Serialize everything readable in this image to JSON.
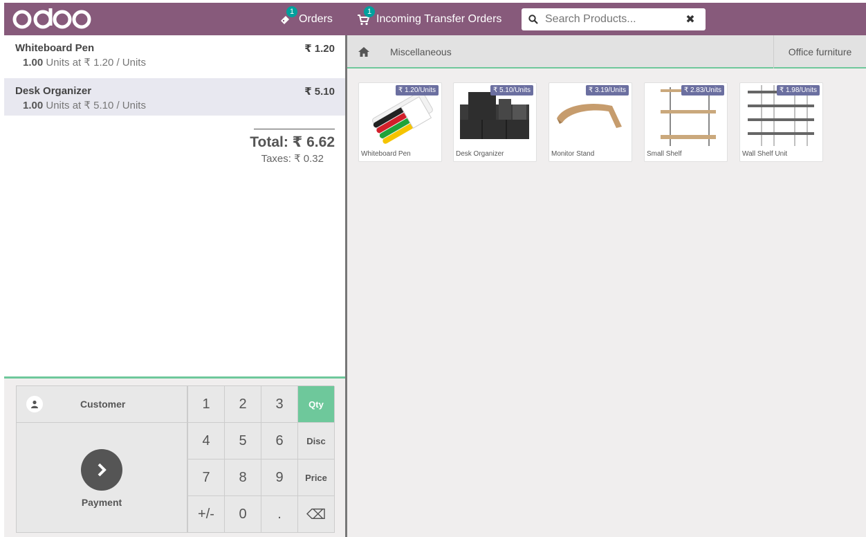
{
  "header": {
    "logo_text": "odoo",
    "orders": {
      "label": "Orders",
      "badge": "1"
    },
    "transfers": {
      "label": "Incoming Transfer Orders",
      "badge": "1"
    },
    "search": {
      "placeholder": "Search Products..."
    },
    "bg_color": "#875a7b",
    "badge_color": "#00a09d"
  },
  "order": {
    "lines": [
      {
        "name": "Whiteboard Pen",
        "price": "₹ 1.20",
        "qty": "1.00",
        "unit_text": "Units at ₹ 1.20 / Units"
      },
      {
        "name": "Desk Organizer",
        "price": "₹ 5.10",
        "qty": "1.00",
        "unit_text": "Units at ₹ 5.10 / Units"
      }
    ],
    "total": "Total: ₹ 6.62",
    "taxes": "Taxes: ₹ 0.32"
  },
  "pad": {
    "customer_label": "Customer",
    "payment_label": "Payment",
    "keys": [
      "1",
      "2",
      "3",
      "Qty",
      "4",
      "5",
      "6",
      "Disc",
      "7",
      "8",
      "9",
      "Price",
      "+/-",
      "0",
      ".",
      "⌫"
    ],
    "active_mode": "Qty",
    "accent_color": "#6ec89b"
  },
  "products_view": {
    "breadcrumb": "Miscellaneous",
    "category_button": "Office furniture",
    "products": [
      {
        "name": "Whiteboard Pen",
        "price_tag": "₹ 1.20/Units",
        "image": "whiteboard-pen-image"
      },
      {
        "name": "Desk Organizer",
        "price_tag": "₹ 5.10/Units",
        "image": "desk-organizer-image"
      },
      {
        "name": "Monitor Stand",
        "price_tag": "₹ 3.19/Units",
        "image": "monitor-stand-image"
      },
      {
        "name": "Small Shelf",
        "price_tag": "₹ 2.83/Units",
        "image": "small-shelf-image"
      },
      {
        "name": "Wall Shelf Unit",
        "price_tag": "₹ 1.98/Units",
        "image": "wall-shelf-unit-image"
      }
    ]
  }
}
